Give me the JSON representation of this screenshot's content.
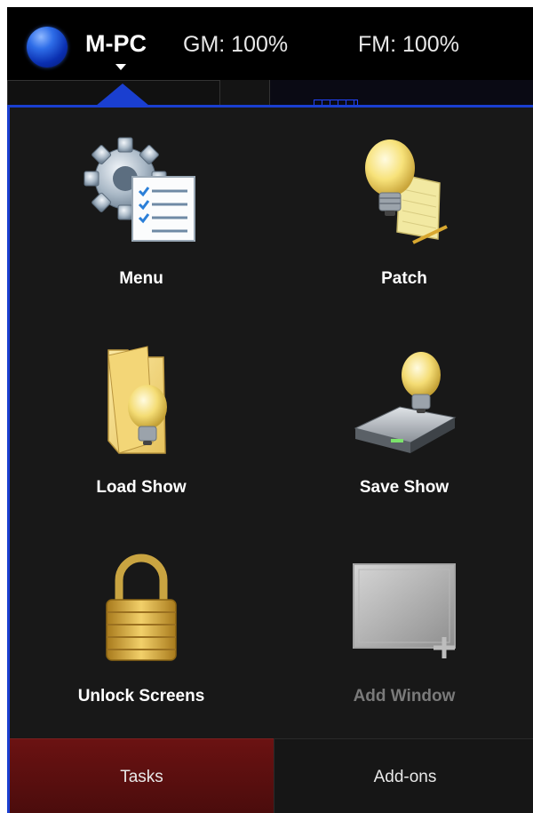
{
  "topbar": {
    "station_name": "M-PC",
    "grand_master": "GM: 100%",
    "fader_master": "FM: 100%"
  },
  "tasks": [
    {
      "label": "Menu",
      "icon": "gear-checklist-icon",
      "enabled": true
    },
    {
      "label": "Patch",
      "icon": "lightbulb-notepad-icon",
      "enabled": true
    },
    {
      "label": "Load Show",
      "icon": "folder-lightbulb-icon",
      "enabled": true
    },
    {
      "label": "Save Show",
      "icon": "drive-lightbulb-icon",
      "enabled": true
    },
    {
      "label": "Unlock Screens",
      "icon": "padlock-icon",
      "enabled": true
    },
    {
      "label": "Add Window",
      "icon": "add-window-icon",
      "enabled": false
    }
  ],
  "tabs": [
    {
      "label": "Tasks",
      "active": true
    },
    {
      "label": "Add-ons",
      "active": false
    }
  ],
  "colors": {
    "accent": "#1a3fd0",
    "active_tab": "#5a0f0f",
    "panel_bg": "#181818"
  }
}
